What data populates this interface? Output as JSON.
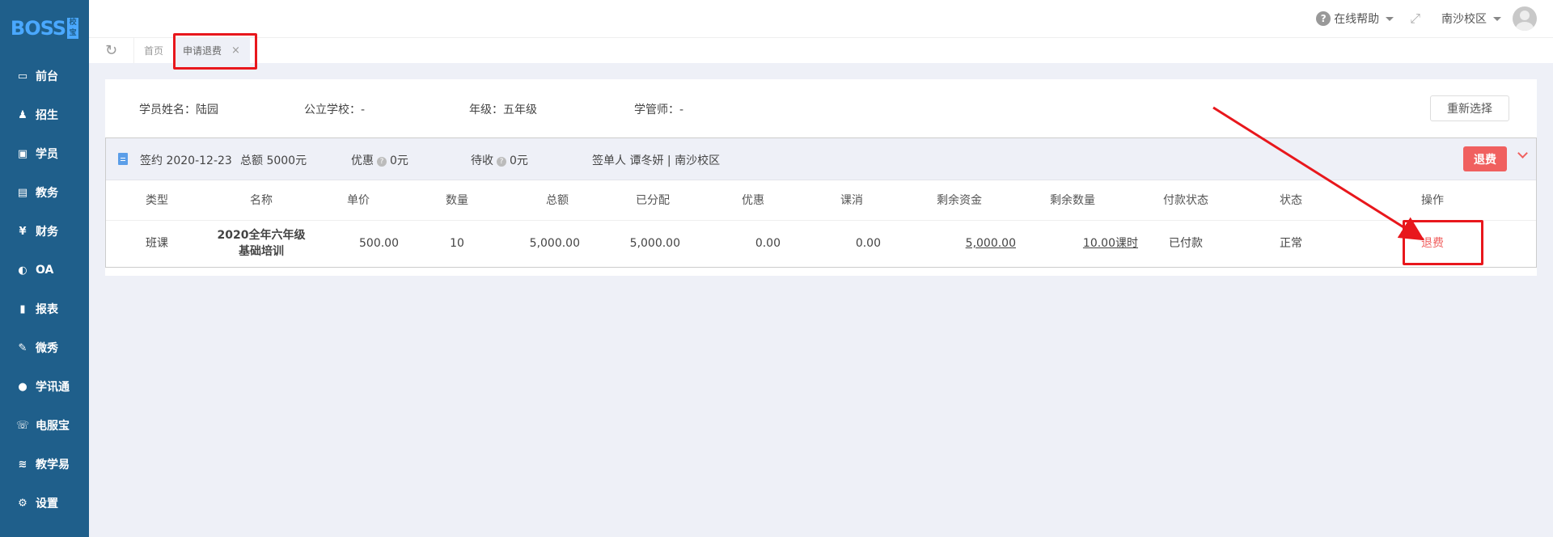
{
  "brand": {
    "logo": "BOSS",
    "badge": "校宝"
  },
  "sidebar": {
    "items": [
      {
        "label": "前台",
        "icon": "desk-icon"
      },
      {
        "label": "招生",
        "icon": "enroll-icon"
      },
      {
        "label": "学员",
        "icon": "student-icon"
      },
      {
        "label": "教务",
        "icon": "book-icon"
      },
      {
        "label": "财务",
        "icon": "yen-icon"
      },
      {
        "label": "OA",
        "icon": "toggle-icon"
      },
      {
        "label": "报表",
        "icon": "bar-chart-icon"
      },
      {
        "label": "微秀",
        "icon": "show-icon"
      },
      {
        "label": "学讯通",
        "icon": "location-icon"
      },
      {
        "label": "电服宝",
        "icon": "phone-icon"
      },
      {
        "label": "教学易",
        "icon": "teach-icon"
      },
      {
        "label": "设置",
        "icon": "gear-icon"
      }
    ]
  },
  "header": {
    "help": "在线帮助",
    "campus": "南沙校区"
  },
  "tabs": [
    {
      "label": "首页"
    },
    {
      "label": "申请退费",
      "close": "×"
    }
  ],
  "student": {
    "name_label": "学员姓名：",
    "name": "陆园",
    "school_label": "公立学校：",
    "school": "-",
    "grade_label": "年级：",
    "grade": "五年级",
    "manager_label": "学管师：",
    "manager": "-",
    "reselect": "重新选择"
  },
  "contract": {
    "signed": "签约 2020-12-23",
    "total": "总额 5000元",
    "discount_label": "优惠",
    "discount": "0元",
    "pending_label": "待收",
    "pending": "0元",
    "signer": "签单人 谭冬妍 | 南沙校区",
    "refund_button": "退费"
  },
  "table": {
    "headers": [
      "类型",
      "名称",
      "单价",
      "数量",
      "总额",
      "已分配",
      "优惠",
      "课消",
      "剩余资金",
      "剩余数量",
      "付款状态",
      "状态",
      "操作"
    ],
    "row": {
      "type": "班课",
      "name_line1": "2020全年六年级",
      "name_line2": "基础培训",
      "price": "500.00",
      "qty": "10",
      "total": "5,000.00",
      "allocated": "5,000.00",
      "discount": "0.00",
      "consumed": "0.00",
      "remaining_funds": "5,000.00",
      "remaining_qty": "10.00课时",
      "pay_status": "已付款",
      "status": "正常",
      "action": "退费"
    }
  },
  "colors": {
    "sidebar": "#1f5f8b",
    "accent_red": "#f0605f",
    "highlight": "#e8171c"
  }
}
